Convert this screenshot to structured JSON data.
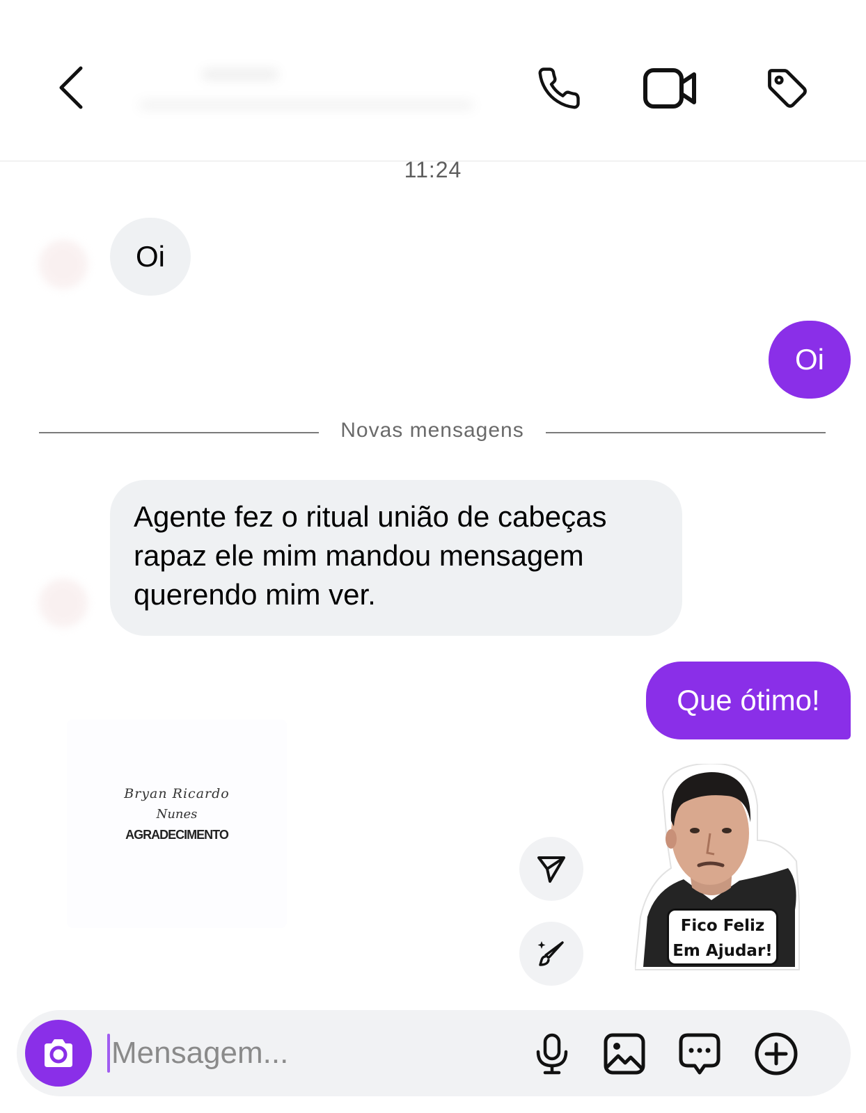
{
  "header": {
    "back_icon": "chevron-left-icon",
    "call_icon": "phone-icon",
    "video_icon": "video-camera-icon",
    "tag_icon": "tag-icon"
  },
  "chat": {
    "timestamp": "11:24",
    "divider_label": "Novas mensagens",
    "messages": [
      {
        "direction": "incoming",
        "text": "Oi"
      },
      {
        "direction": "outgoing",
        "text": "Oi"
      },
      {
        "direction": "incoming",
        "text": "Agente fez o ritual união de cabeças rapaz ele mim mandou mensagem querendo mim ver."
      },
      {
        "direction": "outgoing",
        "text": "Que ótimo!"
      }
    ],
    "card": {
      "signature_line1": "Bryan Ricardo",
      "signature_line2": "Nunes",
      "title": "AGRADECIMENTO"
    },
    "sticker": {
      "line1": "Fico Feliz",
      "line2": "Em Ajudar!"
    }
  },
  "composer": {
    "placeholder": "Mensagem...",
    "value": "",
    "camera_icon": "camera-icon",
    "mic_icon": "microphone-icon",
    "gallery_icon": "image-icon",
    "chat_icon": "chat-bubble-icon",
    "plus_icon": "plus-circle-icon"
  },
  "colors": {
    "accent": "#8a2fe8",
    "incoming_bubble": "#eff1f3",
    "background": "#ffffff"
  }
}
